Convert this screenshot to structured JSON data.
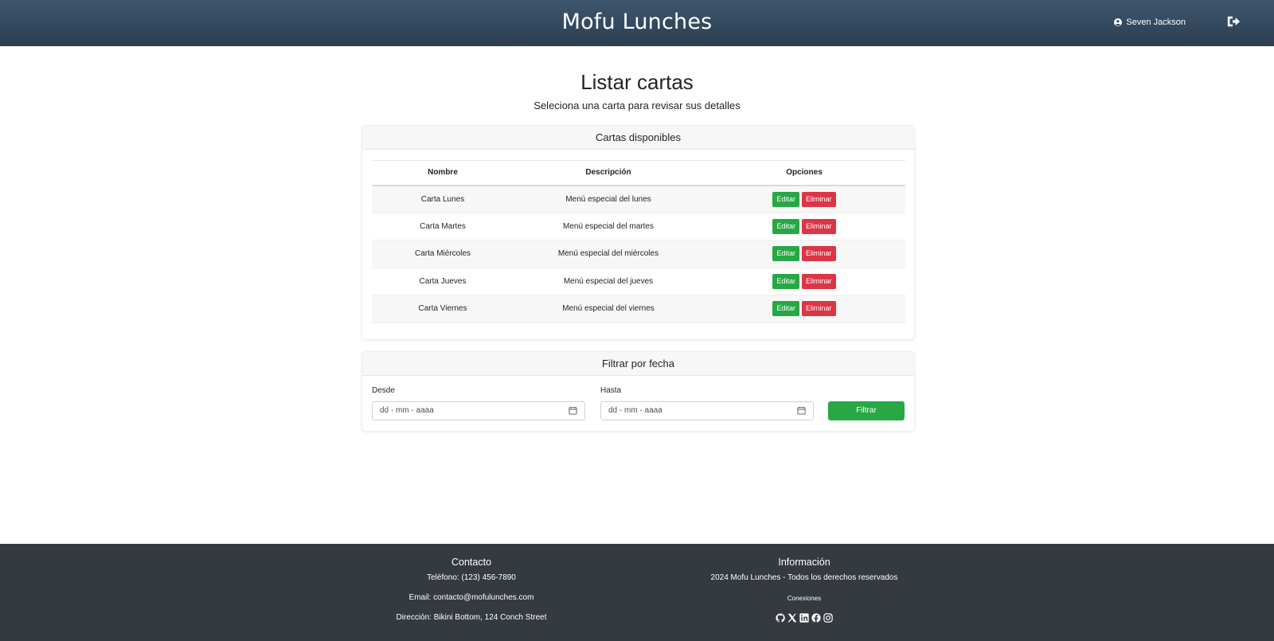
{
  "header": {
    "brand": "Mofu Lunches",
    "user_name": "Seven Jackson",
    "logout_icon": "sign-out-icon",
    "user_icon": "user-circle-icon"
  },
  "main": {
    "title": "Listar cartas",
    "subtitle": "Seleciona una carta para revisar sus detalles"
  },
  "cards_table": {
    "header": "Cartas disponibles",
    "columns": [
      "Nombre",
      "Descripción",
      "Opciones"
    ],
    "rows": [
      {
        "name": "Carta Lunes",
        "description": "Menú especial del lunes",
        "edit": "Editar",
        "delete": "Eliminar"
      },
      {
        "name": "Carta Martes",
        "description": "Menú especial del martes",
        "edit": "Editar",
        "delete": "Eliminar"
      },
      {
        "name": "Carta Miércoles",
        "description": "Menú especial del miércoles",
        "edit": "Editar",
        "delete": "Eliminar"
      },
      {
        "name": "Carta Jueves",
        "description": "Menú especial del jueves",
        "edit": "Editar",
        "delete": "Eliminar"
      },
      {
        "name": "Carta Viernes",
        "description": "Menú especial del viernes",
        "edit": "Editar",
        "delete": "Eliminar"
      }
    ]
  },
  "filter": {
    "header": "Filtrar por fecha",
    "from_label": "Desde",
    "to_label": "Hasta",
    "from_placeholder": "dd - mm - aaaa",
    "to_placeholder": "dd - mm - aaaa",
    "button": "Filtrar"
  },
  "footer": {
    "contact_title": "Contacto",
    "phone": "Teléfono: (123) 456-7890",
    "email": "Email: contacto@mofulunches.com",
    "address": "Dirección: Bikini Bottom, 124 Conch Street",
    "info_title": "Información",
    "copyright": "2024 Mofu Lunches - Todos los derechos reservados",
    "connections": "Conexiones",
    "social_icons": [
      "github-icon",
      "x-twitter-icon",
      "linkedin-icon",
      "facebook-icon",
      "instagram-icon"
    ]
  },
  "colors": {
    "header_bg": "#2c3e50",
    "success": "#28a745",
    "danger": "#dc3545",
    "footer_bg": "#343a40"
  }
}
